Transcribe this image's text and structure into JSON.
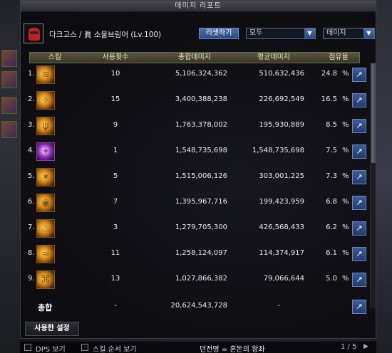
{
  "window": {
    "title": "데미지 리포트"
  },
  "header": {
    "character": "다크고스 / 眞 소울브링어 (Lv.100)",
    "reset_label": "리셋하기",
    "filter_value": "모두",
    "metric_value": "데미지"
  },
  "columns": {
    "skill": "스킬",
    "count": "사용횟수",
    "total": "총합데미지",
    "avg": "평균데미지",
    "share": "점유율"
  },
  "rows": [
    {
      "idx": "1.",
      "count": "10",
      "total": "5,106,324,362",
      "avg": "510,632,436",
      "pct": "24.8",
      "icon": "skill-icon"
    },
    {
      "idx": "2.",
      "count": "15",
      "total": "3,400,388,238",
      "avg": "226,692,549",
      "pct": "16.5",
      "icon": "skill-icon"
    },
    {
      "idx": "3.",
      "count": "9",
      "total": "1,763,378,002",
      "avg": "195,930,889",
      "pct": "8.5",
      "icon": "skill-icon"
    },
    {
      "idx": "4.",
      "count": "1",
      "total": "1,548,735,698",
      "avg": "1,548,735,698",
      "pct": "7.5",
      "icon": "skill-icon"
    },
    {
      "idx": "5.",
      "count": "5",
      "total": "1,515,006,126",
      "avg": "303,001,225",
      "pct": "7.3",
      "icon": "skill-icon"
    },
    {
      "idx": "6.",
      "count": "7",
      "total": "1,395,967,716",
      "avg": "199,423,959",
      "pct": "6.8",
      "icon": "skill-icon"
    },
    {
      "idx": "7.",
      "count": "3",
      "total": "1,279,705,300",
      "avg": "426,568,433",
      "pct": "6.2",
      "icon": "skill-icon"
    },
    {
      "idx": "8.",
      "count": "11",
      "total": "1,258,124,097",
      "avg": "114,374,917",
      "pct": "6.1",
      "icon": "skill-icon"
    },
    {
      "idx": "9.",
      "count": "13",
      "total": "1,027,866,382",
      "avg": "79,066,644",
      "pct": "5.0",
      "icon": "skill-icon"
    }
  ],
  "pct_sign": "%",
  "total": {
    "label": "총합",
    "count": "-",
    "total": "20,624,543,728",
    "avg": "-"
  },
  "tabs": {
    "settings": "사용한 설정"
  },
  "bottom": {
    "dps_label": "DPS 보기",
    "skill_order_label": "스킬 순서 보기",
    "dungeon": "던전명 = 혼돈의 왕좌",
    "page": "1 / 5"
  },
  "colors": {
    "accent": "#2b4a82",
    "header_gold": "#5a5640"
  }
}
